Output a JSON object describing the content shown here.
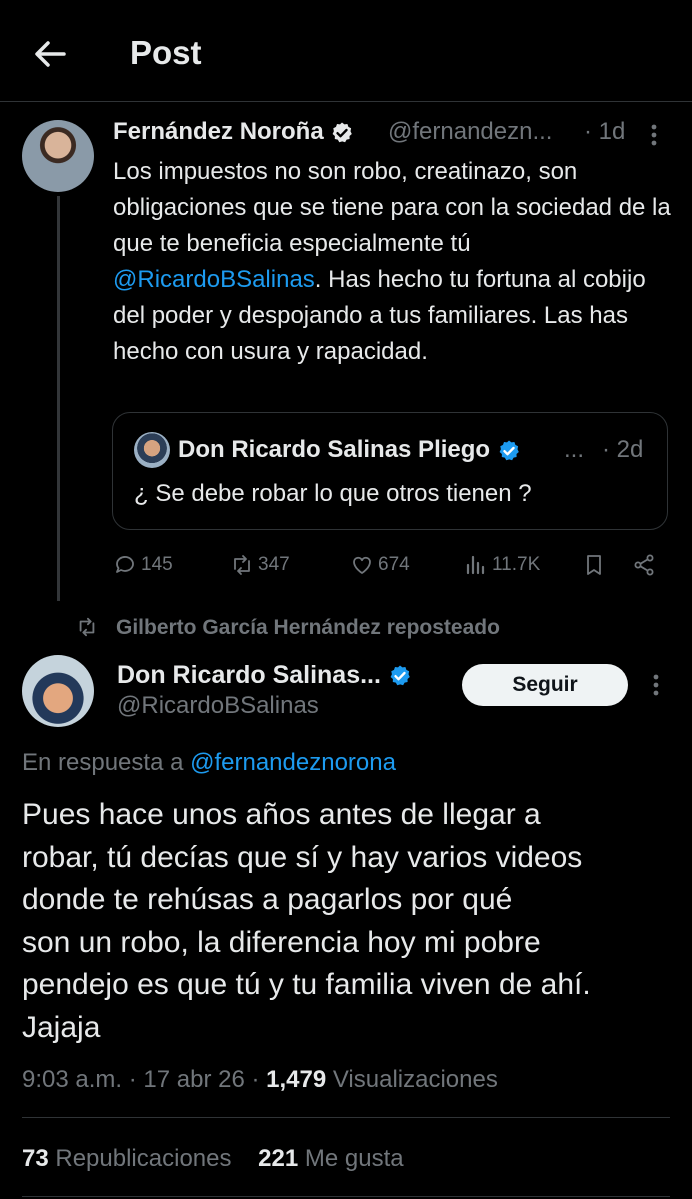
{
  "header": {
    "title": "Post"
  },
  "parent": {
    "name": "Fernández Noroña",
    "handle": "@fernandezn...",
    "time": "· 1d",
    "body_before": "Los impuestos no son robo, creatinazo, son obligaciones que se tiene para con la sociedad de la que te beneficia especialmente tú ",
    "mention": "@RicardoBSalinas",
    "body_after": ". Has hecho tu fortuna al cobijo del poder y despojando a tus familiares. Las has hecho con usura y rapacidad.",
    "quote": {
      "name": "Don Ricardo Salinas Pliego",
      "dots": "...",
      "time": "· 2d",
      "text": "¿ Se debe robar lo que otros tienen ?"
    },
    "actions": {
      "replies": "145",
      "reposts": "347",
      "likes": "674",
      "views": "11.7K"
    }
  },
  "repost_label": "Gilberto García Hernández reposteado",
  "main": {
    "name": "Don Ricardo Salinas...",
    "handle": "@RicardoBSalinas",
    "follow_label": "Seguir",
    "reply_prefix": "En respuesta a ",
    "reply_handle": "@fernandeznorona",
    "body": "Pues hace unos años antes de llegar a\nrobar, tú decías que sí y hay varios videos\ndonde te rehúsas a pagarlos por qué\nson un robo, la diferencia hoy mi pobre\npendejo es que tú y tu familia viven de ahí.\nJajaja",
    "time": "9:03 a.m. · 17 abr 26 · ",
    "views_count": "1,479",
    "views_label": " Visualizaciones",
    "reposts_count": "73",
    "reposts_label": " Republicaciones",
    "likes_count": "221",
    "likes_label": " Me gusta"
  },
  "colors": {
    "accent": "#1d9bf0",
    "muted": "#71767b",
    "text": "#e7e9ea",
    "background": "#000000"
  }
}
